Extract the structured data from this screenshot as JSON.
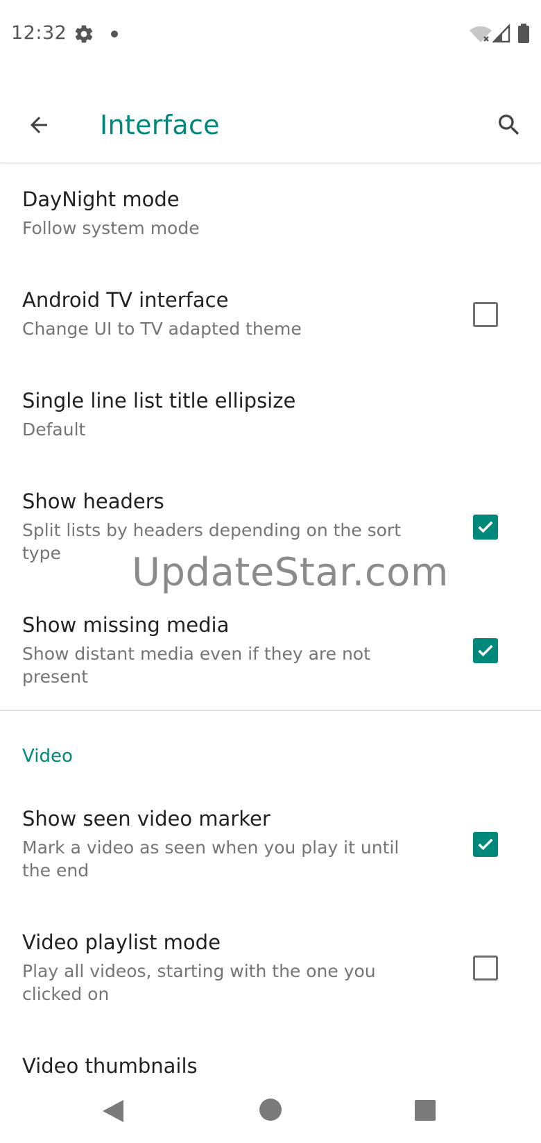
{
  "status_bar": {
    "time": "12:32",
    "icons": [
      "gear-icon",
      "notification-dot-icon",
      "wifi-off-icon",
      "cell-signal-icon",
      "battery-icon"
    ]
  },
  "app_bar": {
    "title": "Interface",
    "back_icon": "arrow-back-icon",
    "search_icon": "search-icon"
  },
  "colors": {
    "accent": "#00897b",
    "title_text": "#212121",
    "summary_text": "#757575"
  },
  "preferences": [
    {
      "title": "DayNight mode",
      "summary": "Follow system mode"
    },
    {
      "title": "Android TV interface",
      "summary": "Change UI to TV adapted theme",
      "checked": false
    },
    {
      "title": "Single line list title ellipsize",
      "summary": "Default"
    },
    {
      "title": "Show headers",
      "summary": "Split lists by headers depending on the sort type",
      "checked": true
    },
    {
      "title": "Show missing media",
      "summary": "Show distant media even if they are not present",
      "checked": true
    }
  ],
  "video_section": {
    "header": "Video",
    "preferences": [
      {
        "title": "Show seen video marker",
        "summary": "Mark a video as seen when you play it until the end",
        "checked": true
      },
      {
        "title": "Video playlist mode",
        "summary": "Play all videos, starting with the one you clicked on",
        "checked": false
      },
      {
        "title": "Video thumbnails",
        "checked": true
      }
    ]
  },
  "watermark": "UpdateStar.com",
  "nav_bar": {
    "icons": [
      "nav-back-icon",
      "nav-home-icon",
      "nav-recents-icon"
    ]
  }
}
